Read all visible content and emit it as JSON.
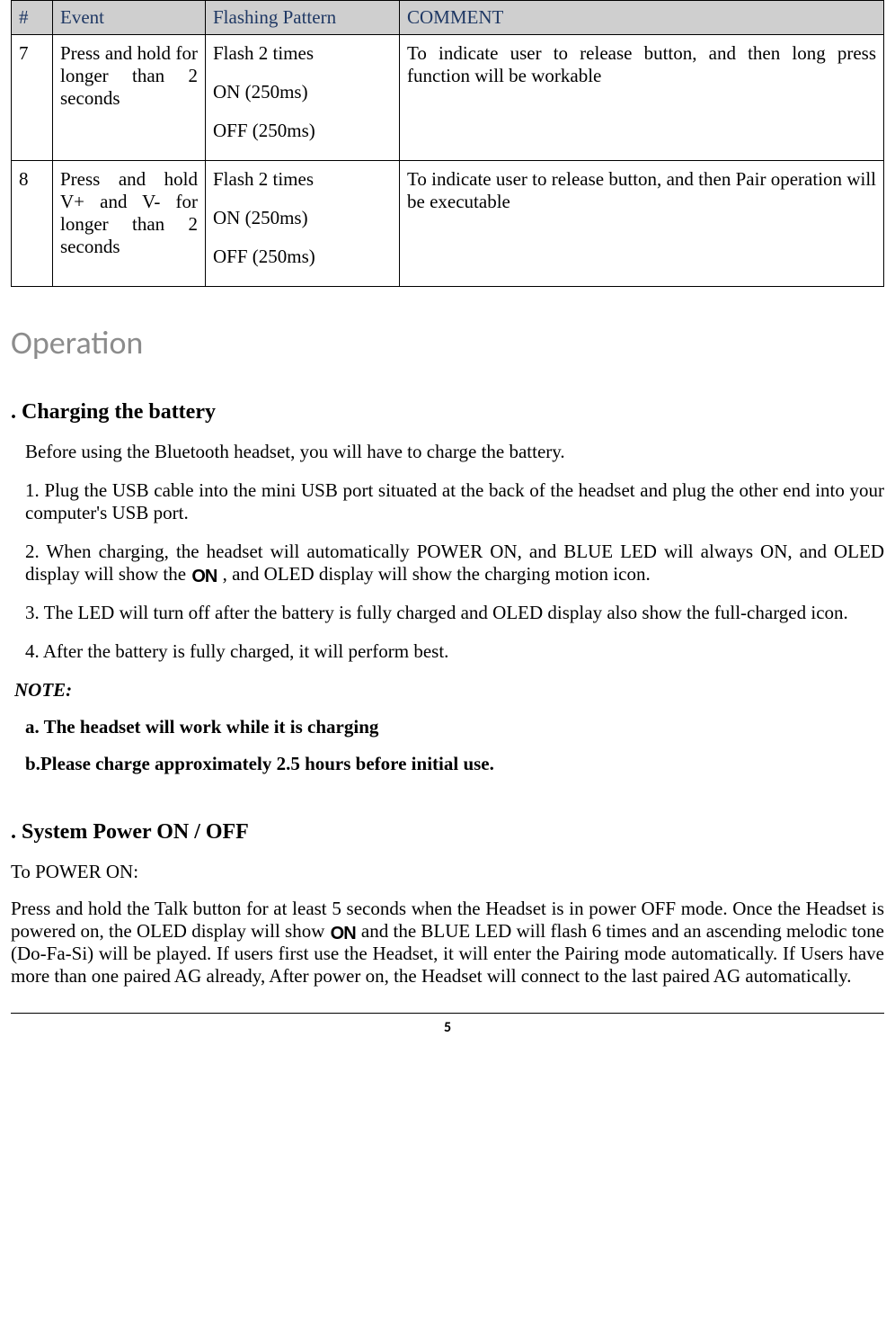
{
  "table": {
    "headers": {
      "num": "#",
      "event": "Event",
      "pattern": "Flashing Pattern",
      "comment": "COMMENT"
    },
    "rows": [
      {
        "num": "7",
        "event": "Press and hold for longer than 2 seconds",
        "pattern_l1": "Flash 2 times",
        "pattern_l2": "ON (250ms)",
        "pattern_l3": "OFF (250ms)",
        "comment": "To indicate user to release button, and then long press function will be workable"
      },
      {
        "num": "8",
        "event": "Press and hold V+ and V- for longer than 2 seconds",
        "pattern_l1": "Flash 2 times",
        "pattern_l2": "ON (250ms)",
        "pattern_l3": "OFF (250ms)",
        "comment": "To indicate user to release button, and then Pair operation will be executable"
      }
    ]
  },
  "section_title": "Operation",
  "charging": {
    "heading": ". Charging the battery",
    "p1": "Before using the Bluetooth headset, you will have to charge the battery.",
    "p2": "1. Plug the USB cable into the mini USB port situated at the back of the headset and plug the other end into your computer's USB port.",
    "p3a": "2. When charging, the headset will automatically POWER ON, and BLUE LED will always ON, and OLED display will show the ",
    "p3b": ", and OLED display will show the charging motion icon.",
    "p4": "3. The LED will turn off after the battery is fully charged and OLED display also show the full-charged icon.",
    "p5": "4. After the battery is fully charged, it will perform best.",
    "note_label": "NOTE:",
    "note_a": "a. The headset will work while it is charging",
    "note_b": "b.Please charge approximately 2.5 hours before initial use."
  },
  "power": {
    "heading": ". System Power ON / OFF",
    "sub": "To POWER ON:",
    "text_a": "Press and hold the Talk button for at least 5 seconds when the Headset is in power OFF mode. Once the Headset is powered on, the OLED display will show ",
    "text_b": " and the BLUE LED will flash 6 times and an ascending melodic tone (Do-Fa-Si) will be played. If users first use the Headset, it will enter the Pairing mode automatically. If Users have more than one paired  AG already, After power on, the Headset will connect to the last paired AG automatically."
  },
  "on_icon_text": "ON",
  "page_number": "5"
}
